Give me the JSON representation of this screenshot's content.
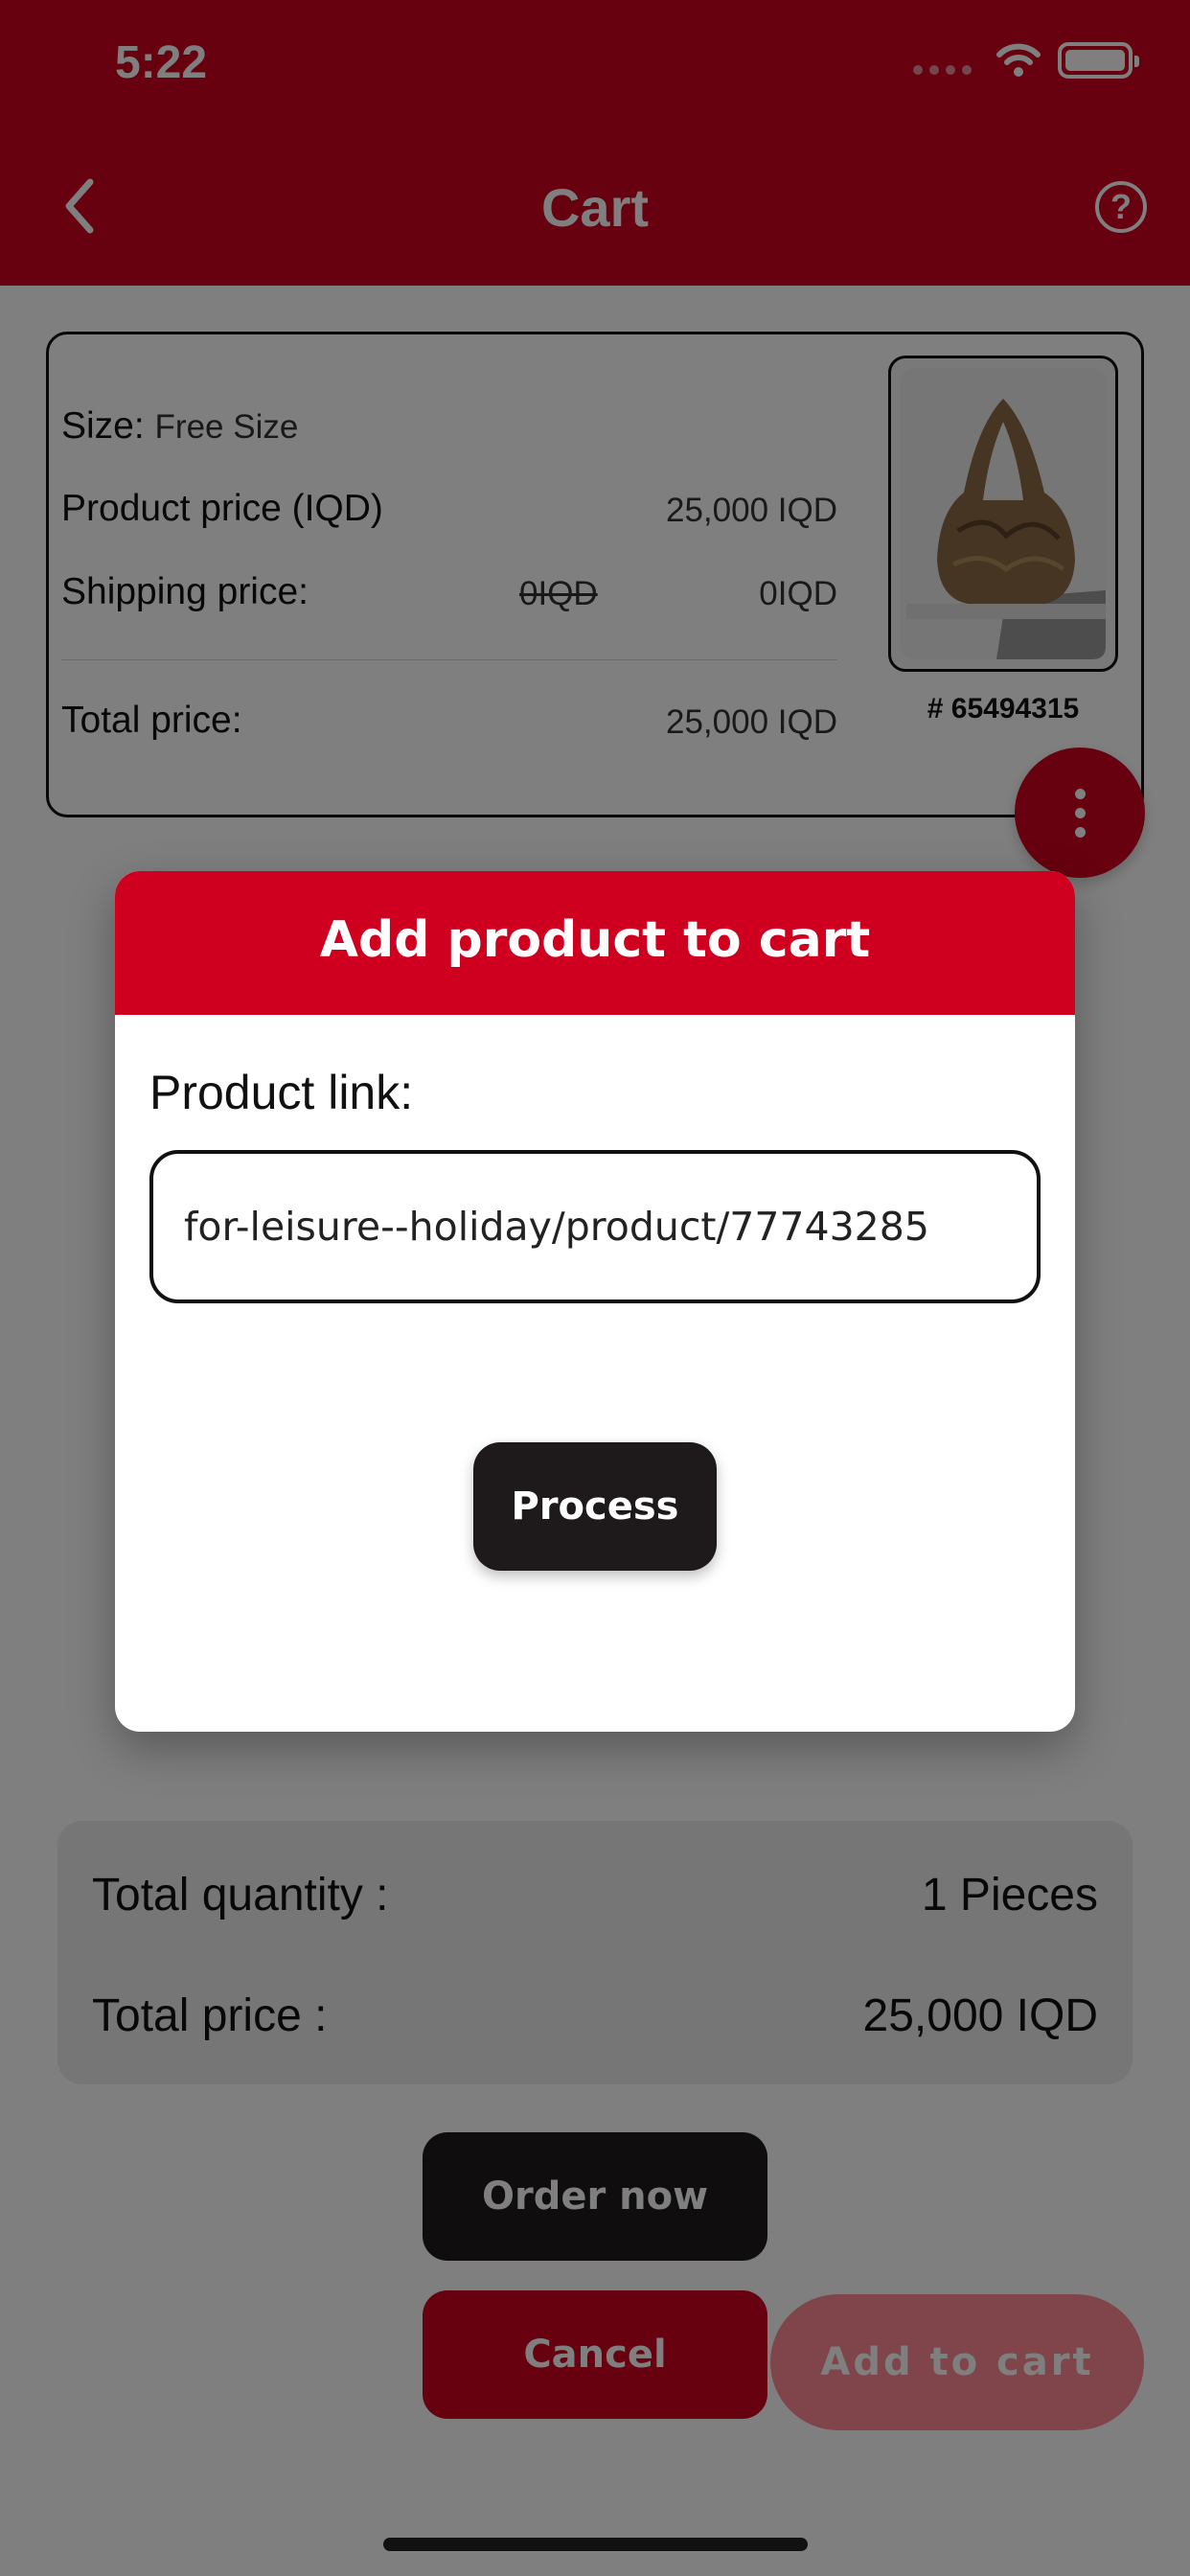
{
  "status_bar": {
    "time": "5:22"
  },
  "header": {
    "title": "Cart",
    "help_icon_glyph": "?",
    "back_icon": "chevron-left-icon"
  },
  "cart_item": {
    "size_label": "Size:",
    "size_value": "Free Size",
    "product_price_label": "Product price (IQD)",
    "product_price_value": "25,000 IQD",
    "shipping_label": "Shipping price:",
    "shipping_old_value": "0IQD",
    "shipping_value": "0IQD",
    "total_label": "Total price:",
    "total_value": "25,000 IQD",
    "product_id": "# 65494315"
  },
  "summary": {
    "quantity_label": "Total quantity :",
    "quantity_value": "1 Pieces",
    "price_label": "Total price :",
    "price_value": "25,000 IQD"
  },
  "actions": {
    "order_now": "Order now",
    "cancel": "Cancel",
    "add_to_cart": "Add to cart"
  },
  "modal": {
    "title": "Add product to cart",
    "link_label": "Product link:",
    "link_value": "for-leisure--holiday/product/77743285",
    "process_label": "Process"
  },
  "colors": {
    "brand_red": "#cf001f",
    "dark_button": "#1e1a1b",
    "add_to_cart_pink": "#ff8a94",
    "overlay": "rgba(0,0,0,0.5)"
  }
}
